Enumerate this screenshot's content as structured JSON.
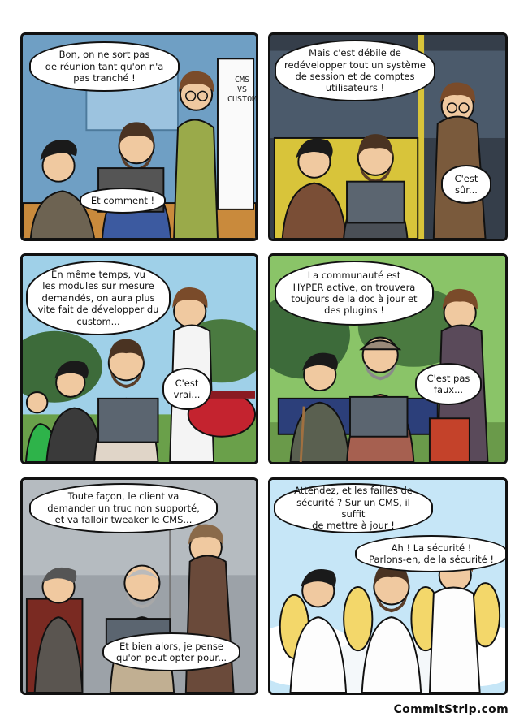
{
  "panels": [
    {
      "bubbles": [
        "Bon,  on ne sort pas\nde réunion tant qu'on n'a\npas tranché !",
        "Et comment !"
      ],
      "sign": "CMS\nVS\nCUSTOM"
    },
    {
      "bubbles": [
        "Mais c'est débile de\nredévelopper tout un système\nde session et de comptes\nutilisateurs !",
        "C'est\nsûr..."
      ]
    },
    {
      "bubbles": [
        "En même temps, vu\nles modules sur mesure\ndemandés,  on aura plus\nvite fait de développer du\ncustom...",
        "C'est\nvrai..."
      ]
    },
    {
      "bubbles": [
        "La communauté est\nHYPER active, on trouvera\ntoujours de la doc à jour et\ndes plugins !",
        "C'est pas\nfaux..."
      ]
    },
    {
      "bubbles": [
        "Toute façon,  le client va\ndemander un truc non supporté,\net va falloir tweaker le CMS...",
        "Et bien alors, je pense\nqu'on peut opter pour..."
      ]
    },
    {
      "bubbles": [
        "Attendez, et les failles de\nsécurité ? Sur un CMS,  il suffit\nde mettre à jour !",
        "Ah !  La sécurité !\nParlons-en, de la sécurité !"
      ]
    }
  ],
  "footer": "CommitStrip.com",
  "colors": {
    "outline": "#111111",
    "skin": "#f0c9a0",
    "wall_blue": "#7aa7c9",
    "bus_yellow": "#d8c43a",
    "sky": "#9fd0e8",
    "park_green": "#3d6b3a",
    "hospital_grey": "#9aa0a6",
    "heaven_blue": "#bfe3f5"
  }
}
